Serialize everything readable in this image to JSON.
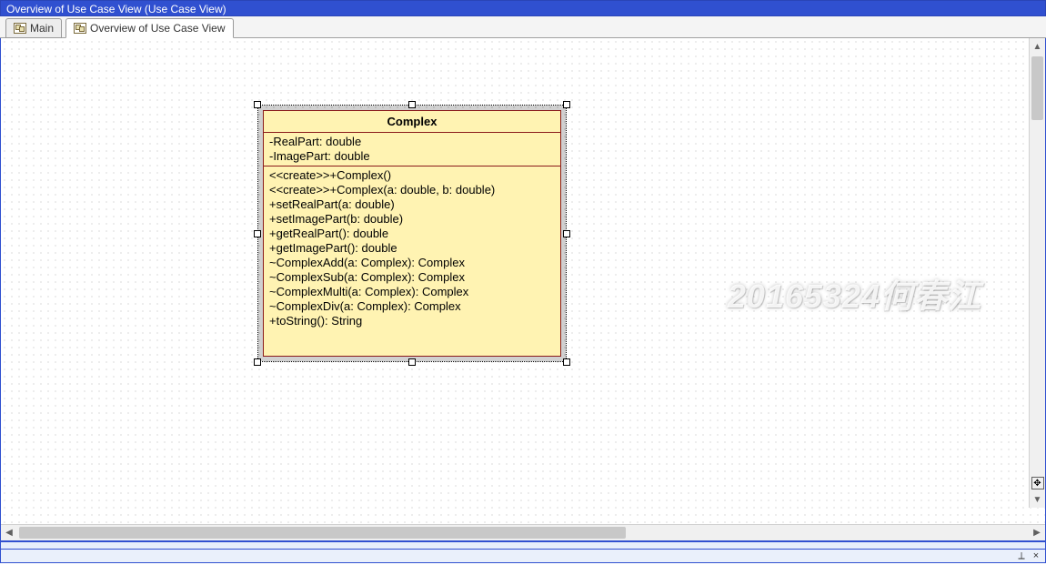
{
  "window": {
    "title": "Overview of Use Case View (Use Case View)"
  },
  "tabs": [
    {
      "label": "Main",
      "active": false
    },
    {
      "label": "Overview of Use Case View",
      "active": true
    }
  ],
  "uml": {
    "class_name": "Complex",
    "attributes": [
      "-RealPart: double",
      "-ImagePart: double"
    ],
    "operations": [
      "<<create>>+Complex()",
      "<<create>>+Complex(a: double, b: double)",
      "+setRealPart(a: double)",
      "+setImagePart(b: double)",
      "+getRealPart(): double",
      "+getImagePart(): double",
      "~ComplexAdd(a: Complex): Complex",
      "~ComplexSub(a: Complex): Complex",
      "~ComplexMulti(a: Complex): Complex",
      "~ComplexDiv(a: Complex): Complex",
      "+toString(): String"
    ]
  },
  "watermark": "20165324何春江",
  "dock": {
    "pin": "⟂",
    "close": "×"
  }
}
